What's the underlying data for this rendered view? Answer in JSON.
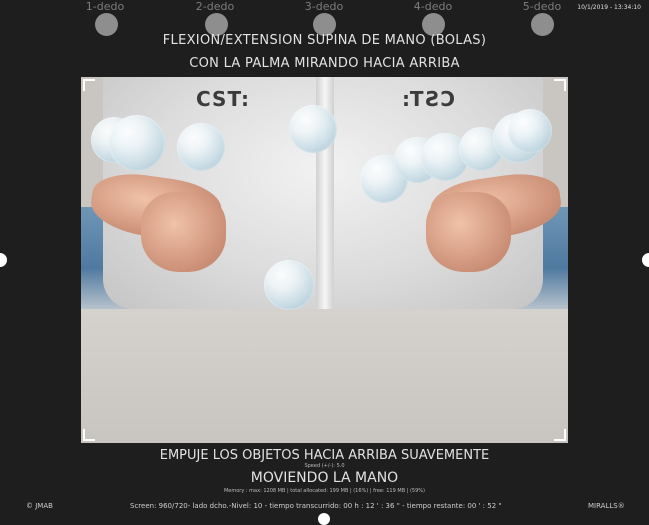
{
  "fingers": [
    "1-dedo",
    "2-dedo",
    "3-dedo",
    "4-dedo",
    "5-dedo"
  ],
  "timestamp": "10/1/2019 - 13:34:10",
  "title": {
    "line1": "FLEXION/EXTENSION SUPINA DE MANO (BOLAS)",
    "line2": "CON LA PALMA MIRANDO HACIA ARRIBA"
  },
  "scene": {
    "logo_left": "CST:",
    "logo_right": "CST:"
  },
  "instructions": {
    "line1": "EMPUJE LOS OBJETOS HACIA ARRIBA SUAVEMENTE",
    "speed": "Speed (+/-): 5.0",
    "line2": "MOVIENDO LA MANO",
    "memory": "Memory : max: 1208 MB | total allocated: 199 MB | (16%) | free: 119 MB | (59%)"
  },
  "footer": {
    "left": "© JMAB",
    "center": "Screen: 960/720- lado dcho.-Nivel: 10 - tiempo transcurrido: 00 h : 12 ' : 36 \" - tiempo restante: 00 ' : 52 \"",
    "right": "MIRALLS®"
  }
}
